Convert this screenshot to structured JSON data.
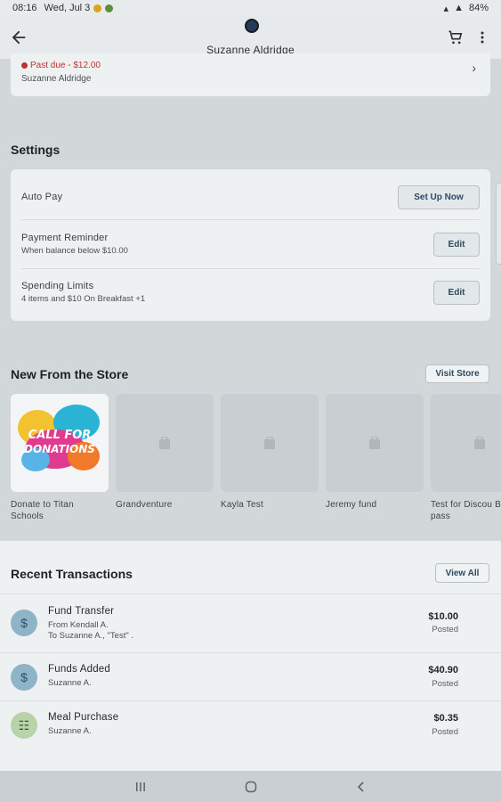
{
  "status_bar": {
    "time": "08:16",
    "date": "Wed, Jul 3",
    "battery": "84%"
  },
  "header": {
    "title": "Suzanne Aldridge"
  },
  "bill": {
    "past_due": "Past due - $12.00",
    "name": "Suzanne Aldridge"
  },
  "settings": {
    "title": "Settings",
    "rows": [
      {
        "label": "Auto Pay",
        "sub": "",
        "button": "Set Up Now"
      },
      {
        "label": "Payment Reminder",
        "sub": "When balance below $10.00",
        "button": "Edit"
      },
      {
        "label": "Spending Limits",
        "sub": "4 items and $10 On Breakfast +1",
        "button": "Edit"
      }
    ]
  },
  "store": {
    "title": "New From the Store",
    "visit_label": "Visit Store",
    "items": [
      {
        "label": "Donate to Titan Schools",
        "image_text": "CALL FOR DONATIONS"
      },
      {
        "label": "Grandventure"
      },
      {
        "label": "Kayla Test"
      },
      {
        "label": "Jeremy fund"
      },
      {
        "label": "Test for Discou Bus pass"
      }
    ]
  },
  "transactions": {
    "title": "Recent Transactions",
    "view_all": "View All",
    "items": [
      {
        "title": "Fund Transfer",
        "sub1": "From Kendall A.",
        "sub2": "To Suzanne A., \"Test\" .",
        "amount": "$10.00",
        "status": "Posted",
        "icon": "dollar-icon"
      },
      {
        "title": "Funds Added",
        "sub1": "Suzanne A.",
        "sub2": "",
        "amount": "$40.90",
        "status": "Posted",
        "icon": "dollar-icon"
      },
      {
        "title": "Meal Purchase",
        "sub1": "Suzanne A.",
        "sub2": "",
        "amount": "$0.35",
        "status": "Posted",
        "icon": "meal-icon"
      }
    ]
  },
  "colors": {
    "accent": "#2e4a5f",
    "past_due": "#c0312d",
    "page_bg": "#d2d7da",
    "card_bg": "#eef1f2"
  }
}
